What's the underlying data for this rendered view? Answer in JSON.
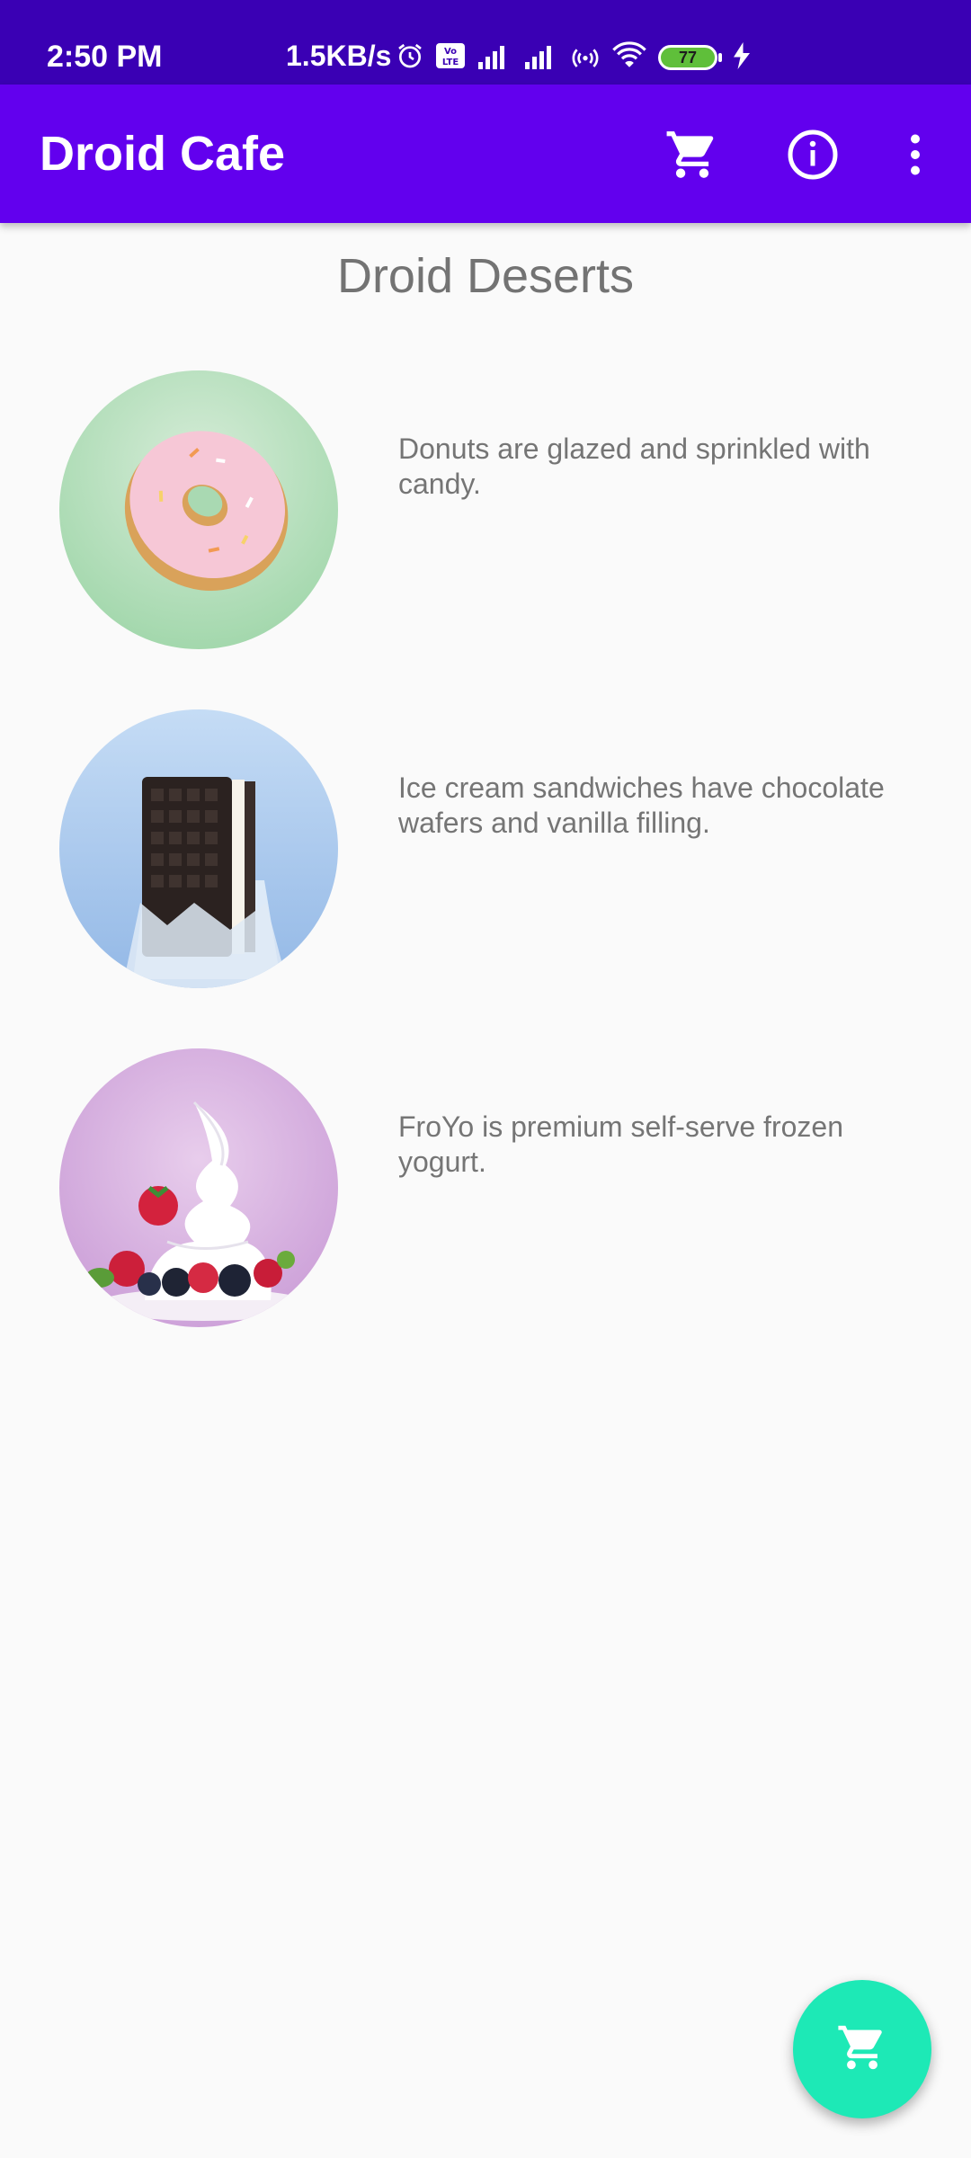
{
  "status_bar": {
    "time": "2:50 PM",
    "network_speed": "1.5KB/s",
    "battery_level": "77",
    "icons": [
      "alarm-icon",
      "volte-icon",
      "signal-icon",
      "signal-icon",
      "hotspot-icon",
      "wifi-icon",
      "battery-icon",
      "charging-icon"
    ]
  },
  "app_bar": {
    "title": "Droid Cafe",
    "actions": [
      "cart-icon",
      "info-icon",
      "more-vert-icon"
    ]
  },
  "main": {
    "title": "Droid Deserts",
    "items": [
      {
        "name": "donut",
        "description": "Donuts are glazed and sprinkled with candy.",
        "image_background": "#a8d8b0"
      },
      {
        "name": "ice-cream-sandwich",
        "description": "Ice cream sandwiches have chocolate wafers and vanilla filling.",
        "image_background": "#b3d3f3"
      },
      {
        "name": "froyo",
        "description": "FroYo is premium self-serve frozen yogurt.",
        "image_background": "#d9b3e3"
      }
    ]
  },
  "fab": {
    "icon": "cart-icon",
    "color": "#1de9b6"
  },
  "colors": {
    "status_bar": "#3a00b4",
    "app_bar": "#6200ee",
    "background": "#fafafa",
    "text": "#757575"
  }
}
